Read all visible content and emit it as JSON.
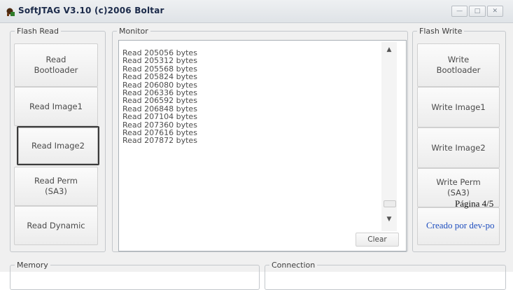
{
  "window": {
    "title": "SoftJTAG V3.10 (c)2006 Boltar",
    "buttons": [
      "—",
      "□",
      "✕"
    ]
  },
  "flash_read": {
    "legend": "Flash Read",
    "buttons": [
      "Read\nBootloader",
      "Read Image1",
      "Read Image2",
      "Read Perm\n(SA3)",
      "Read Dynamic"
    ]
  },
  "monitor": {
    "legend": "Monitor",
    "log": [
      "Read 205056 bytes",
      "Read 205312 bytes",
      "Read 205568 bytes",
      "Read 205824 bytes",
      "Read 206080 bytes",
      "Read 206336 bytes",
      "Read 206592 bytes",
      "Read 206848 bytes",
      "Read 207104 bytes",
      "Read 207360 bytes",
      "Read 207616 bytes",
      "Read 207872 bytes"
    ],
    "clear_label": "Clear"
  },
  "flash_write": {
    "legend": "Flash Write",
    "buttons": [
      "Write\nBootloader",
      "Write Image1",
      "Write Image2",
      "Write Perm\n(SA3)"
    ]
  },
  "bottom": {
    "memory_legend": "Memory",
    "connection_legend": "Connection"
  },
  "overlay": {
    "page_label": "Página 4/5",
    "created_by": "Creado por dev-po",
    "created_color": "#1f4fbf"
  }
}
